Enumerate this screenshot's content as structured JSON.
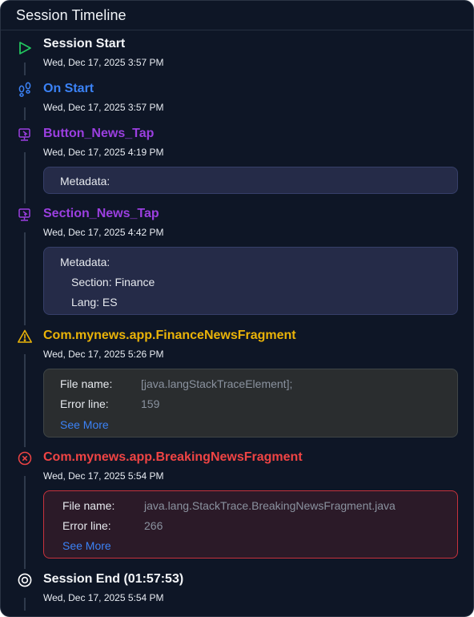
{
  "header": {
    "title": "Session Timeline"
  },
  "colors": {
    "start": "#22c55e",
    "lifecycle": "#3b82f6",
    "interaction": "#9b3fe0",
    "warning": "#eab308",
    "error": "#ef4444",
    "end": "#ffffff"
  },
  "events": [
    {
      "icon": "play-icon",
      "title": "Session Start",
      "time": "Wed, Dec 17, 2025 3:57 PM"
    },
    {
      "icon": "footsteps-icon",
      "title": "On Start",
      "time": "Wed, Dec 17, 2025 3:57 PM"
    },
    {
      "icon": "monitor-click-icon",
      "title": "Button_News_Tap",
      "time": "Wed, Dec 17, 2025 4:19 PM",
      "metadata": {
        "label": "Metadata:"
      }
    },
    {
      "icon": "monitor-click-icon",
      "title": "Section_News_Tap",
      "time": "Wed, Dec 17, 2025 4:42 PM",
      "metadata": {
        "label": "Metadata:",
        "lines": [
          "Section: Finance",
          "Lang: ES"
        ]
      }
    },
    {
      "icon": "warning-triangle-icon",
      "title": "Com.mynews.app.FinanceNewsFragment",
      "time": "Wed, Dec 17, 2025 5:26 PM",
      "details": {
        "file_label": "File name:",
        "file_value": "[java.langStackTraceElement];",
        "line_label": "Error line:",
        "line_value": "159",
        "see_more": "See More"
      }
    },
    {
      "icon": "error-circle-icon",
      "title": "Com.mynews.app.BreakingNewsFragment",
      "time": "Wed, Dec 17, 2025 5:54 PM",
      "details": {
        "file_label": "File name:",
        "file_value": "java.lang.StackTrace.BreakingNewsFragment.java",
        "line_label": "Error line:",
        "line_value": "266",
        "see_more": "See More"
      }
    },
    {
      "icon": "stop-circle-icon",
      "title": "Session End (01:57:53)",
      "time": "Wed, Dec 17, 2025 5:54 PM"
    }
  ]
}
